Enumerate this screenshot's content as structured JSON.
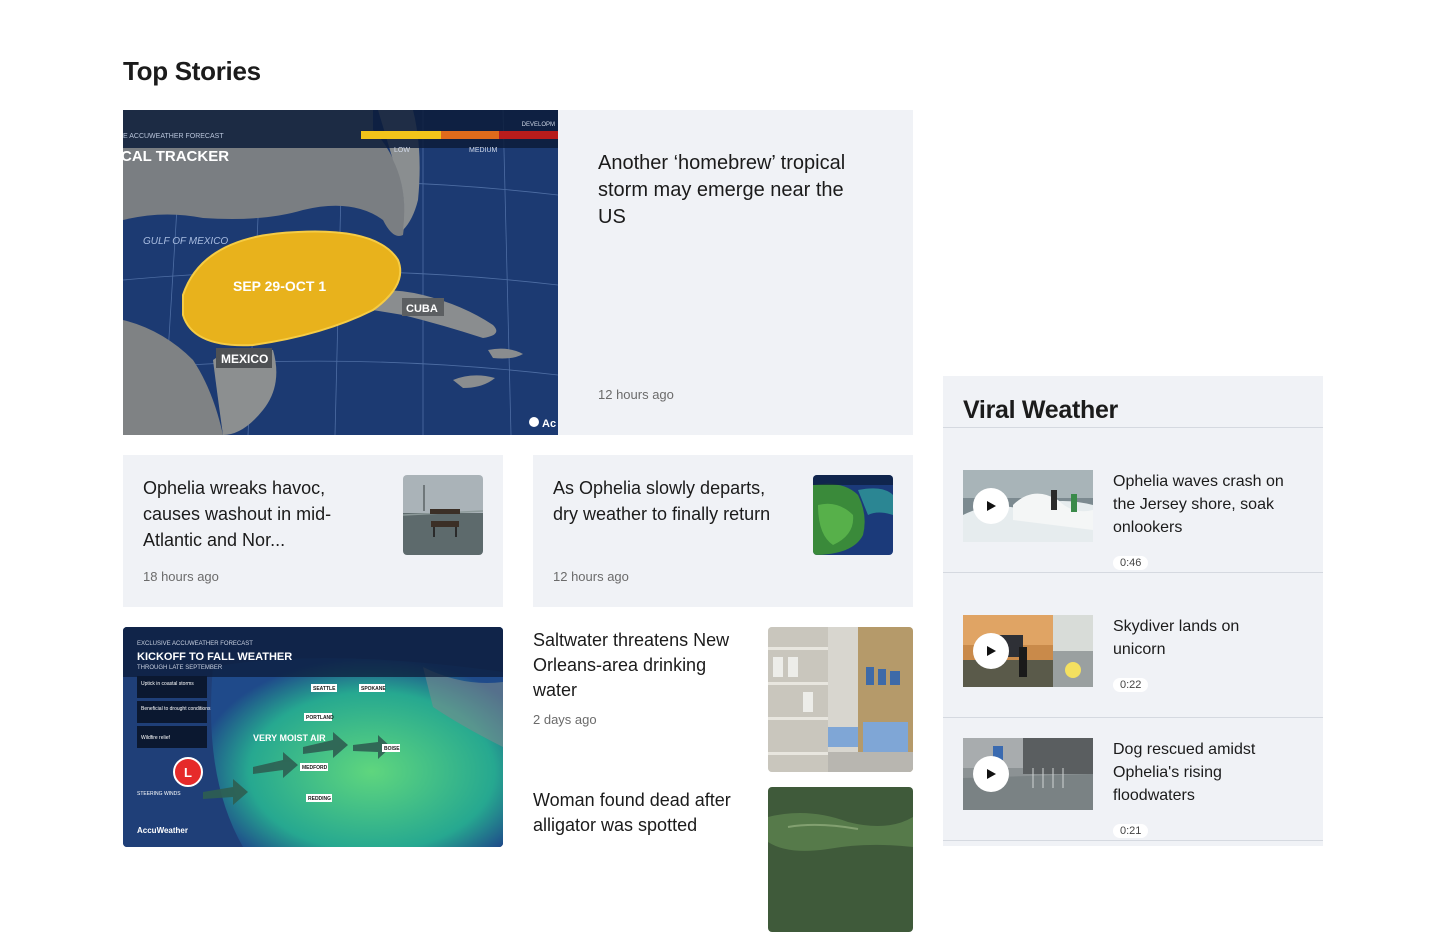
{
  "page": {
    "section_title": "Top Stories"
  },
  "hero": {
    "title": "Another ‘homebrew’ tropical storm may emerge near the US",
    "time": "12 hours ago",
    "image": {
      "header_line": "E ACCUWEATHER FORECAST",
      "tracker_label": "CAL TRACKER",
      "scale_right_label": "DEVELOPM",
      "scale_low": "LOW",
      "scale_medium": "MEDIUM",
      "gulf_label": "GULF OF MEXICO",
      "dates_label": "SEP 29-OCT 1",
      "cuba_label": "CUBA",
      "mexico_label": "MEXICO",
      "brand": "Ac"
    }
  },
  "cards": [
    {
      "title": "Ophelia wreaks havoc, causes washout in mid-Atlantic and Nor...",
      "time": "18 hours ago"
    },
    {
      "title": "As Ophelia slowly departs, dry weather to finally return",
      "time": "12 hours ago"
    }
  ],
  "bottom_image": {
    "header_line": "EXCLUSIVE ACCUWEATHER FORECAST",
    "title": "KICKOFF TO FALL WEATHER",
    "subtitle": "THROUGH LATE SEPTEMBER",
    "legend": [
      "Uptick in coastal storms",
      "Beneficial to drought conditions",
      "Wildfire relief"
    ],
    "moist_label": "VERY MOIST AIR",
    "low_symbol": "L",
    "steering_label": "STEERING WINDS",
    "city_labels": [
      "SEATTLE",
      "SPOKANE",
      "PORTLAND",
      "BOISE",
      "MEDFORD",
      "REDDING"
    ],
    "brand": "AccuWeather"
  },
  "stories": [
    {
      "title": "Saltwater threatens New Orleans-area drinking water",
      "time": "2 days ago"
    },
    {
      "title": "Woman found dead after alligator was spotted"
    }
  ],
  "viral": {
    "title": "Viral Weather",
    "items": [
      {
        "title": "Ophelia waves crash on the Jersey shore, soak onlookers",
        "duration": "0:46"
      },
      {
        "title": "Skydiver lands on unicorn",
        "duration": "0:22"
      },
      {
        "title": "Dog rescued amidst Ophelia's rising floodwaters",
        "duration": "0:21"
      }
    ]
  },
  "colors": {
    "card_bg": "#f0f2f6",
    "forecast_cone": "#e8b21c",
    "map_ocean": "#1a3870"
  },
  "icons": {
    "play": "play-icon"
  }
}
